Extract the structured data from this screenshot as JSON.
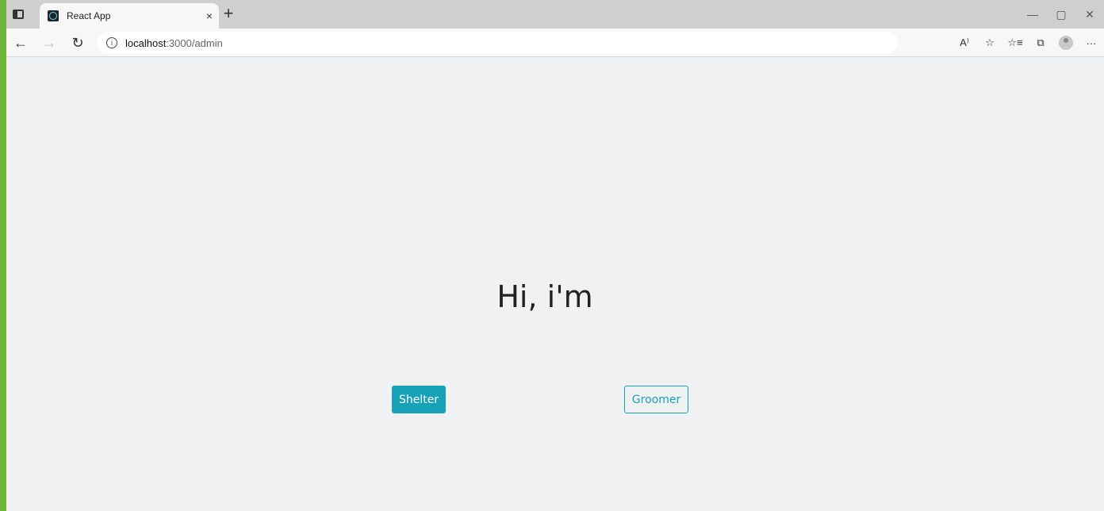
{
  "browser": {
    "tab": {
      "title": "React App",
      "close": "×"
    },
    "new_tab": "+",
    "window_controls": {
      "minimize": "—",
      "restore": "▢",
      "close": "✕"
    },
    "nav": {
      "back": "←",
      "forward": "→",
      "refresh": "↻"
    },
    "address": {
      "host": "localhost",
      "path": ":3000/admin",
      "info": "i"
    },
    "toolbar_icons": {
      "read_aloud": "A⁾",
      "add_favorite": "☆",
      "favorites": "☆≡",
      "collections": "⧉",
      "more": "···"
    }
  },
  "page": {
    "heading": "Hi, i'm",
    "buttons": {
      "shelter": "Shelter",
      "groomer": "Groomer"
    }
  },
  "colors": {
    "accent": "#17a2b8",
    "page_background": "#f0f1f3",
    "left_accent": "#6fb43b"
  }
}
